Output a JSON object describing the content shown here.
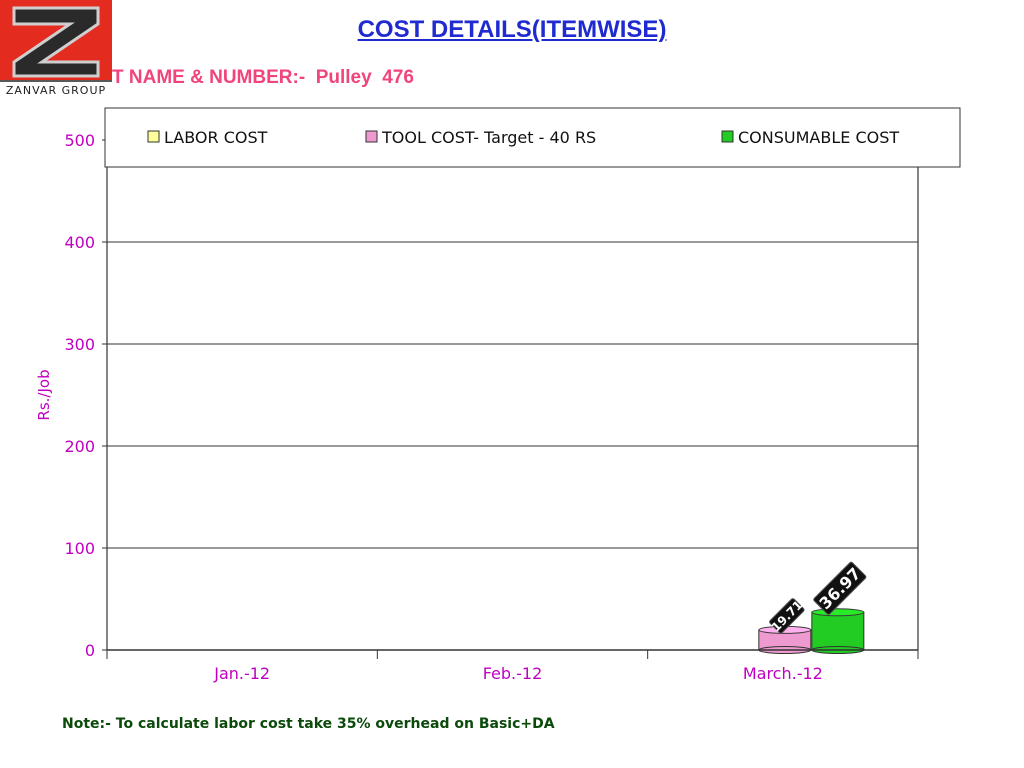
{
  "header": {
    "title": "COST DETAILS(ITEMWISE)",
    "subtitle": "T NAME & NUMBER:-  Pulley  476",
    "logo_text": "ZANVAR  GROUP"
  },
  "note": "Note:- To calculate labor cost take 35% overhead on Basic+DA",
  "colors": {
    "title": "#1f2bd1",
    "subtitle": "#f0447b",
    "axis_text": "#c000c0",
    "labor": "#ffff99",
    "tool": "#ee9ad0",
    "consumable": "#22cc22",
    "logo_bg": "#e32b20"
  },
  "chart_data": {
    "type": "bar",
    "categories": [
      "Jan.-12",
      "Feb.-12",
      "March.-12"
    ],
    "series": [
      {
        "name": "LABOR COST",
        "values": [
          null,
          null,
          null
        ]
      },
      {
        "name": "TOOL COST- Target - 40 RS",
        "values": [
          null,
          null,
          19.71
        ]
      },
      {
        "name": "CONSUMABLE COST",
        "values": [
          null,
          null,
          36.97
        ]
      }
    ],
    "data_labels": {
      "tool": "19.71",
      "consumable": "36.97"
    },
    "ylabel": "Rs./Job",
    "yticks": [
      "0",
      "100",
      "200",
      "300",
      "400",
      "500"
    ],
    "ylim": [
      0,
      500
    ],
    "grid": true,
    "legend_position": "top"
  }
}
